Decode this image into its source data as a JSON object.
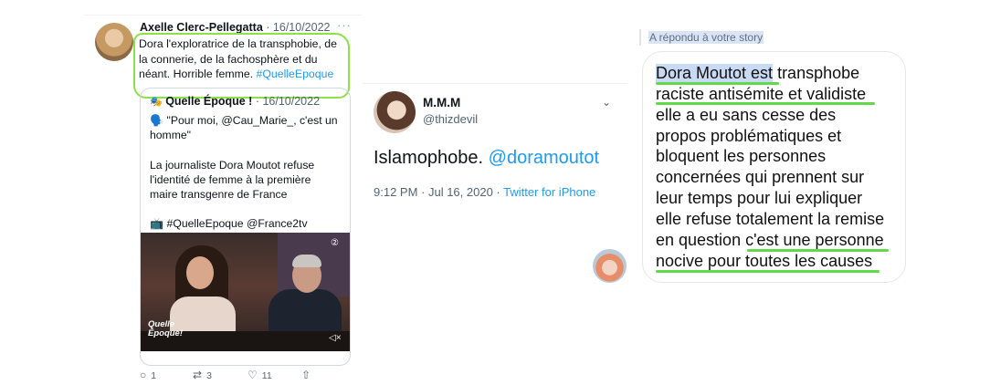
{
  "left_tweet": {
    "author": "Axelle Clerc-Pellegatta",
    "date": "· 16/10/2022",
    "more": "···",
    "text_lines": [
      "Dora l'exploratrice de la transphobie, de",
      "la connerie, de la fachosphère et du",
      "néant. Horrible femme."
    ],
    "hashtag": "#QuelleEpoque",
    "quote": {
      "icon": "🎭",
      "author": "Quelle Époque !",
      "date": "· 16/10/2022",
      "para1_lines": [
        "🗣️ \"Pour moi, @Cau_Marie_, c'est un",
        "homme\""
      ],
      "para2_lines": [
        "La journaliste Dora Moutot refuse",
        "l'identité de femme à la première",
        "maire transgenre de France"
      ],
      "para3": "📺 #QuelleEpoque @France2tv",
      "video_logo_line1": "Quelle",
      "video_logo_line2": "Époque!"
    },
    "actions": {
      "reply_count": "1",
      "retweet_count": "3",
      "like_count": "11"
    }
  },
  "middle_tweet": {
    "name": "M.M.M",
    "handle": "@thizdevil",
    "text": "Islamophobe.",
    "mention": "@doramoutot",
    "time": "9:12 PM · Jul 16, 2020 · ",
    "source": "Twitter for iPhone"
  },
  "story_reply": {
    "label": "A répondu à votre story",
    "line1_highlight": "Dora Moutot est",
    "line1_rest": " transphobe",
    "lines": [
      "raciste antisémite et validiste",
      "elle a eu sans cesse des",
      "propos problématiques et",
      "bloquent les personnes",
      "concernées qui prennent sur",
      "leur temps pour lui expliquer",
      "elle refuse totalement la remise",
      "en question c'est une personne",
      "nocive pour toutes les causes"
    ]
  },
  "colors": {
    "twitter_blue": "#1d9bf0",
    "highlight_green": "#8ee04a",
    "underline_green": "#62d94a",
    "text_highlight_blue": "#c9daf4"
  }
}
